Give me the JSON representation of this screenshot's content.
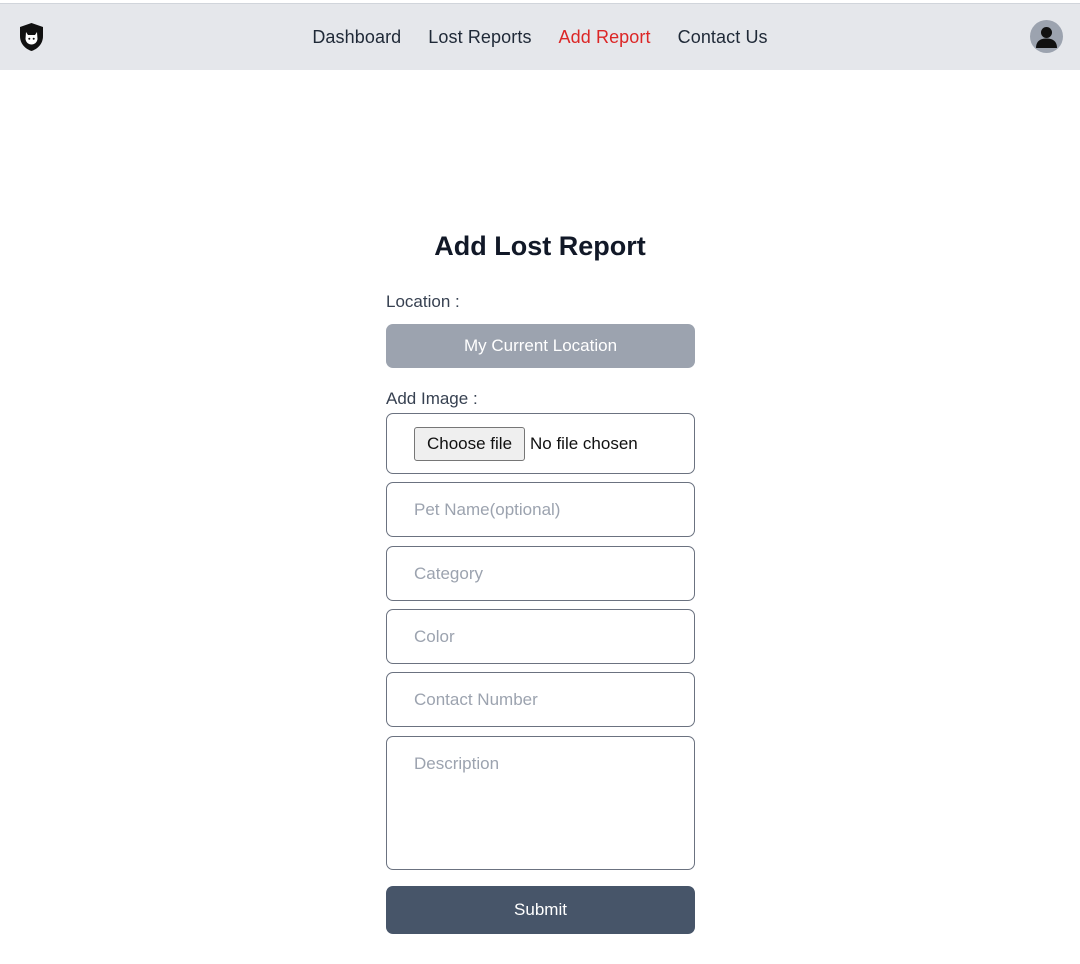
{
  "nav": {
    "links": [
      "Dashboard",
      "Lost Reports",
      "Add Report",
      "Contact Us"
    ],
    "active": "Add Report"
  },
  "icons": {
    "logo": "shield-cat-icon",
    "avatar": "user-avatar-icon"
  },
  "colors": {
    "active_link": "#dc2626",
    "submit": "#475569",
    "location_button": "#9ca3af",
    "topbar": "#e5e7eb"
  },
  "form": {
    "title": "Add Lost Report",
    "location_label": "Location :",
    "location_button": "My Current Location",
    "image_label": "Add Image :",
    "file_button": "Choose file",
    "file_status": "No file chosen",
    "pet_name_placeholder": "Pet Name(optional)",
    "category_placeholder": "Category",
    "color_placeholder": "Color",
    "contact_placeholder": "Contact Number",
    "description_placeholder": "Description",
    "submit_label": "Submit"
  }
}
